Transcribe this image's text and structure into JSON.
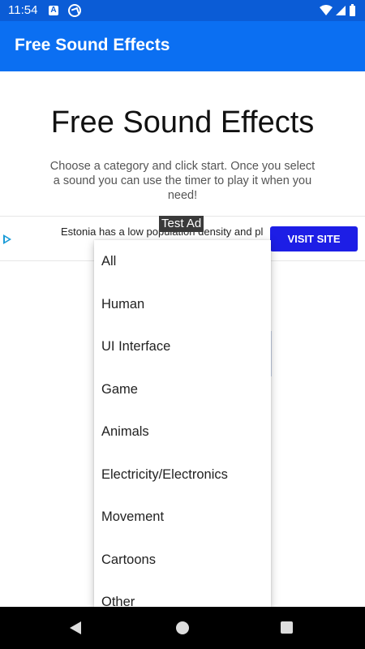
{
  "status_bar": {
    "time": "11:54",
    "icons": [
      "a-icon",
      "at-icon",
      "wifi-icon",
      "signal-icon",
      "battery-icon"
    ]
  },
  "app_bar": {
    "title": "Free Sound Effects",
    "color": "#0b6ff2"
  },
  "main": {
    "title": "Free Sound Effects",
    "description": "Choose a category and click start. Once you select a sound you can use the timer to play it when you need!"
  },
  "ad": {
    "label": "Test Ad",
    "text": "Estonia has a low population density and pl",
    "button_label": "VISIT SITE",
    "button_color": "#1d1ee6",
    "icon": "ad-choices-icon"
  },
  "dropdown": {
    "items": [
      "All",
      "Human",
      "UI Interface",
      "Game",
      "Animals",
      "Electricity/Electronics",
      "Movement",
      "Cartoons",
      "Other"
    ]
  },
  "nav_bar": {
    "icons": [
      "back-icon",
      "home-icon",
      "recents-icon"
    ]
  }
}
